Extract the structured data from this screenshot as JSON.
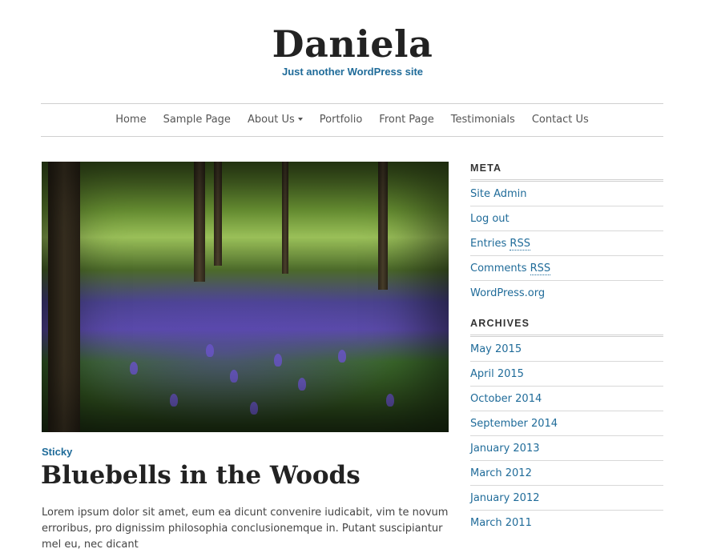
{
  "site": {
    "title": "Daniela",
    "tagline": "Just another WordPress site"
  },
  "nav": {
    "items": [
      {
        "label": "Home"
      },
      {
        "label": "Sample Page"
      },
      {
        "label": "About Us"
      },
      {
        "label": "Portfolio"
      },
      {
        "label": "Front Page"
      },
      {
        "label": "Testimonials"
      },
      {
        "label": "Contact Us"
      }
    ]
  },
  "post": {
    "badge": "Sticky",
    "title": "Bluebells in the Woods",
    "excerpt": "Lorem ipsum dolor sit amet, eum ea dicunt convenire iudicabit, vim te novum erroribus, pro dignissim philosophia conclusionemque in. Putant suscipiantur mel eu, nec dicant"
  },
  "sidebar": {
    "meta": {
      "title": "META",
      "items": [
        {
          "label": "Site Admin"
        },
        {
          "label": "Log out"
        },
        {
          "prefix": "Entries ",
          "abbr": "RSS"
        },
        {
          "prefix": "Comments ",
          "abbr": "RSS"
        },
        {
          "label": "WordPress.org"
        }
      ]
    },
    "archives": {
      "title": "ARCHIVES",
      "items": [
        {
          "label": "May 2015"
        },
        {
          "label": "April 2015"
        },
        {
          "label": "October 2014"
        },
        {
          "label": "September 2014"
        },
        {
          "label": "January 2013"
        },
        {
          "label": "March 2012"
        },
        {
          "label": "January 2012"
        },
        {
          "label": "March 2011"
        }
      ]
    }
  },
  "colors": {
    "link": "#1f6b99",
    "title": "#222222",
    "border": "#cfcfcf"
  }
}
